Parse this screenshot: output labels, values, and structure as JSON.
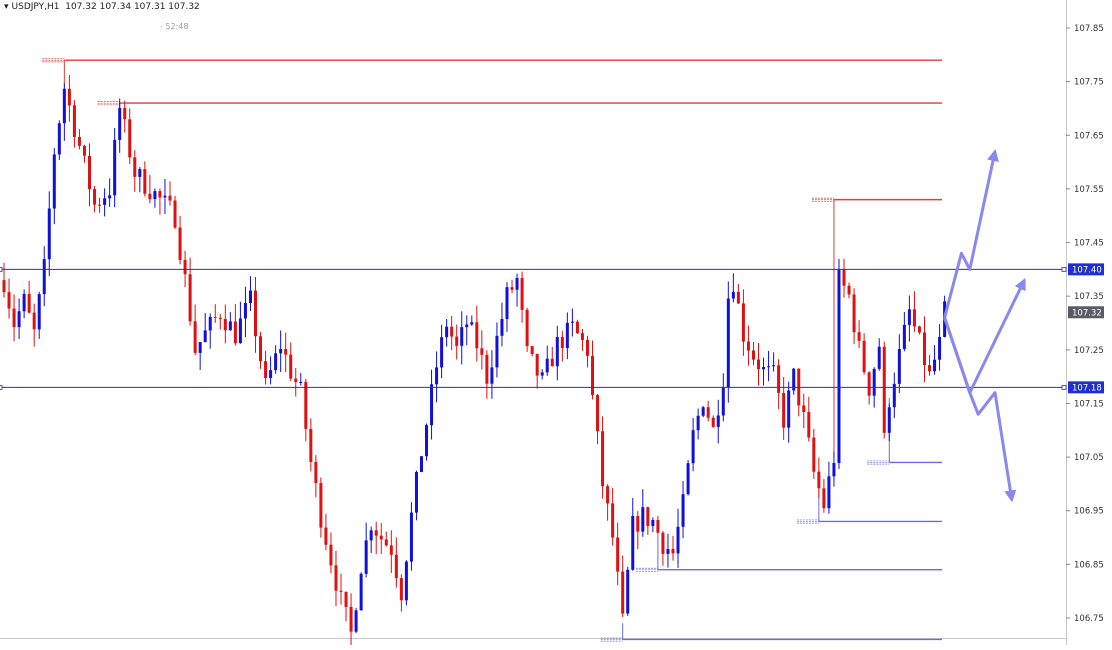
{
  "header": {
    "symbol": "USDJPY,H1",
    "ohlc": "107.32 107.34 107.31 107.32",
    "timer": "- 52:48"
  },
  "colors": {
    "bull": "#1010d8",
    "bear": "#e01010",
    "level_red": "#e53a3a",
    "level_blue": "#6a6ae8",
    "arrow": "#8888ee",
    "price_tag_blue": "#1f2fd0",
    "price_tag_grey": "#5a5a66"
  },
  "chart_data": {
    "type": "candlestick",
    "ylim": [
      106.695,
      107.895
    ],
    "y_ticks": [
      "107.85",
      "107.75",
      "107.65",
      "107.55",
      "107.45",
      "107.35",
      "107.25",
      "107.15",
      "107.05",
      "106.95",
      "106.85",
      "106.75"
    ],
    "price_tags": [
      {
        "label": "107.40",
        "value": 107.4,
        "color": "blue"
      },
      {
        "label": "107.32",
        "value": 107.32,
        "color": "grey"
      },
      {
        "label": "107.18",
        "value": 107.18,
        "color": "blue"
      }
    ],
    "horizontal_lines": [
      {
        "value": 107.4,
        "color": "blue",
        "extent": "full"
      },
      {
        "value": 107.18,
        "color": "blue",
        "extent": "full"
      }
    ],
    "levels": [
      {
        "value": 107.79,
        "kind": "resistance",
        "start_bar": 12
      },
      {
        "value": 107.71,
        "kind": "resistance",
        "start_bar": 23
      },
      {
        "value": 107.53,
        "kind": "resistance",
        "start_bar": 165
      },
      {
        "value": 107.04,
        "kind": "support",
        "start_bar": 176
      },
      {
        "value": 106.93,
        "kind": "support",
        "start_bar": 162
      },
      {
        "value": 106.84,
        "kind": "support",
        "start_bar": 130
      },
      {
        "value": 106.71,
        "kind": "support",
        "start_bar": 123
      }
    ],
    "path_points": [
      [
        0,
        107.38
      ],
      [
        2,
        107.3
      ],
      [
        4,
        107.34
      ],
      [
        6,
        107.28
      ],
      [
        8,
        107.4
      ],
      [
        10,
        107.62
      ],
      [
        12,
        107.74
      ],
      [
        15,
        107.63
      ],
      [
        18,
        107.52
      ],
      [
        21,
        107.55
      ],
      [
        23,
        107.7
      ],
      [
        26,
        107.58
      ],
      [
        29,
        107.55
      ],
      [
        32,
        107.52
      ],
      [
        34,
        107.5
      ],
      [
        36,
        107.38
      ],
      [
        38,
        107.25
      ],
      [
        40,
        107.28
      ],
      [
        43,
        107.32
      ],
      [
        46,
        107.28
      ],
      [
        49,
        107.34
      ],
      [
        52,
        107.18
      ],
      [
        55,
        107.26
      ],
      [
        57,
        107.21
      ],
      [
        59,
        107.17
      ],
      [
        61,
        107.04
      ],
      [
        63,
        106.94
      ],
      [
        65,
        106.86
      ],
      [
        67,
        106.78
      ],
      [
        69,
        106.72
      ],
      [
        71,
        106.85
      ],
      [
        73,
        106.93
      ],
      [
        75,
        106.9
      ],
      [
        77,
        106.88
      ],
      [
        79,
        106.8
      ],
      [
        81,
        106.94
      ],
      [
        83,
        107.06
      ],
      [
        86,
        107.22
      ],
      [
        88,
        107.3
      ],
      [
        90,
        107.25
      ],
      [
        92,
        107.3
      ],
      [
        94,
        107.26
      ],
      [
        96,
        107.2
      ],
      [
        98,
        107.27
      ],
      [
        100,
        107.35
      ],
      [
        102,
        107.38
      ],
      [
        104,
        107.24
      ],
      [
        107,
        107.19
      ],
      [
        110,
        107.26
      ],
      [
        113,
        107.29
      ],
      [
        116,
        107.25
      ],
      [
        117,
        107.16
      ],
      [
        119,
        107.0
      ],
      [
        121,
        106.9
      ],
      [
        123,
        106.74
      ],
      [
        125,
        106.92
      ],
      [
        127,
        106.94
      ],
      [
        129,
        106.93
      ],
      [
        131,
        106.89
      ],
      [
        133,
        106.87
      ],
      [
        135,
        106.96
      ],
      [
        137,
        107.09
      ],
      [
        139,
        107.16
      ],
      [
        141,
        107.1
      ],
      [
        143,
        107.2
      ],
      [
        144,
        107.35
      ],
      [
        145,
        107.38
      ],
      [
        147,
        107.28
      ],
      [
        149,
        107.24
      ],
      [
        151,
        107.21
      ],
      [
        153,
        107.2
      ],
      [
        155,
        107.12
      ],
      [
        157,
        107.2
      ],
      [
        159,
        107.12
      ],
      [
        161,
        107.02
      ],
      [
        163,
        106.96
      ],
      [
        165,
        107.05
      ],
      [
        166,
        107.38
      ],
      [
        168,
        107.35
      ],
      [
        170,
        107.25
      ],
      [
        172,
        107.18
      ],
      [
        174,
        107.26
      ],
      [
        175,
        107.08
      ],
      [
        176,
        107.16
      ],
      [
        178,
        107.24
      ],
      [
        180,
        107.32
      ],
      [
        182,
        107.26
      ],
      [
        184,
        107.2
      ],
      [
        186,
        107.26
      ],
      [
        187,
        107.32
      ]
    ],
    "arrows": [
      {
        "points": [
          [
            107.31,
            0
          ],
          [
            107.43,
            4
          ],
          [
            107.4,
            6
          ],
          [
            107.62,
            12
          ]
        ]
      },
      {
        "points": [
          [
            107.31,
            0
          ],
          [
            107.17,
            6
          ],
          [
            107.38,
            19
          ]
        ]
      },
      {
        "points": [
          [
            107.31,
            0
          ],
          [
            107.17,
            6
          ],
          [
            107.13,
            8
          ],
          [
            107.17,
            12
          ],
          [
            106.97,
            16
          ]
        ]
      }
    ]
  }
}
